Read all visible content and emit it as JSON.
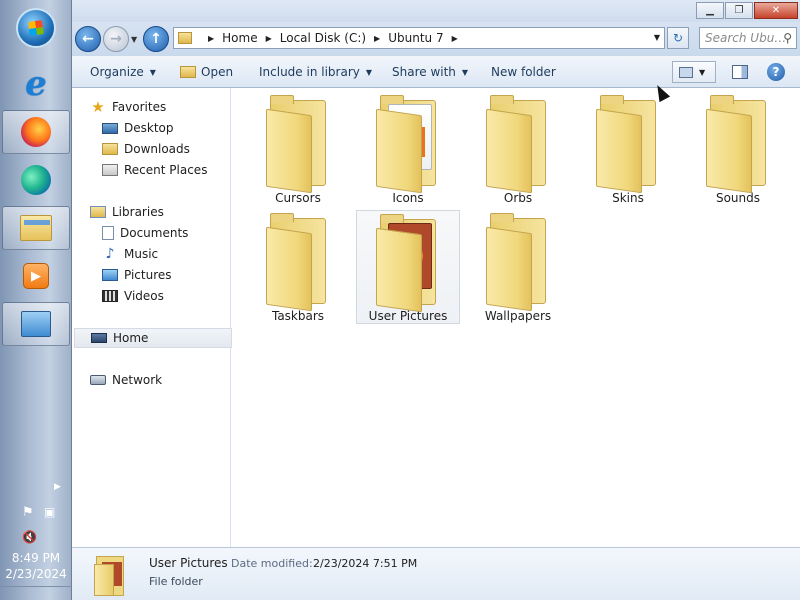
{
  "taskbar": {
    "items": [
      {
        "name": "start-orb",
        "icon": "windows-orb-icon"
      },
      {
        "name": "internet-explorer",
        "icon": "internet-explorer-icon"
      },
      {
        "name": "firefox",
        "icon": "firefox-icon"
      },
      {
        "name": "edge",
        "icon": "edge-icon"
      },
      {
        "name": "windows-explorer",
        "icon": "folder-icon"
      },
      {
        "name": "media-player",
        "icon": "media-player-icon"
      },
      {
        "name": "control-panel",
        "icon": "control-panel-icon"
      }
    ],
    "clock": {
      "time": "8:49 PM",
      "date": "2/23/2024"
    }
  },
  "window": {
    "address": {
      "crumbs": [
        "Home",
        "Local Disk (C:)",
        "Ubuntu 7"
      ]
    },
    "search_placeholder": "Search Ubu…",
    "commands": {
      "organize": "Organize",
      "open": "Open",
      "include": "Include in library",
      "share": "Share with",
      "new_folder": "New folder"
    },
    "navigation": {
      "favorites": "Favorites",
      "desktop": "Desktop",
      "downloads": "Downloads",
      "recent": "Recent Places",
      "libraries": "Libraries",
      "documents": "Documents",
      "music": "Music",
      "pictures": "Pictures",
      "videos": "Videos",
      "home": "Home",
      "network": "Network"
    },
    "folders": [
      {
        "label": "Cursors",
        "type": "plain",
        "selected": false
      },
      {
        "label": "Icons",
        "type": "icons",
        "selected": false
      },
      {
        "label": "Orbs",
        "type": "plain",
        "selected": false
      },
      {
        "label": "Skins",
        "type": "plain",
        "selected": false
      },
      {
        "label": "Sounds",
        "type": "plain",
        "selected": false
      },
      {
        "label": "Taskbars",
        "type": "plain",
        "selected": false
      },
      {
        "label": "User Pictures",
        "type": "ubuntu",
        "selected": true
      },
      {
        "label": "Wallpapers",
        "type": "plain",
        "selected": false
      }
    ],
    "details": {
      "name": "User Pictures",
      "modified_label": "Date modified:",
      "modified_value": "2/23/2024 7:51 PM",
      "type": "File folder"
    }
  }
}
